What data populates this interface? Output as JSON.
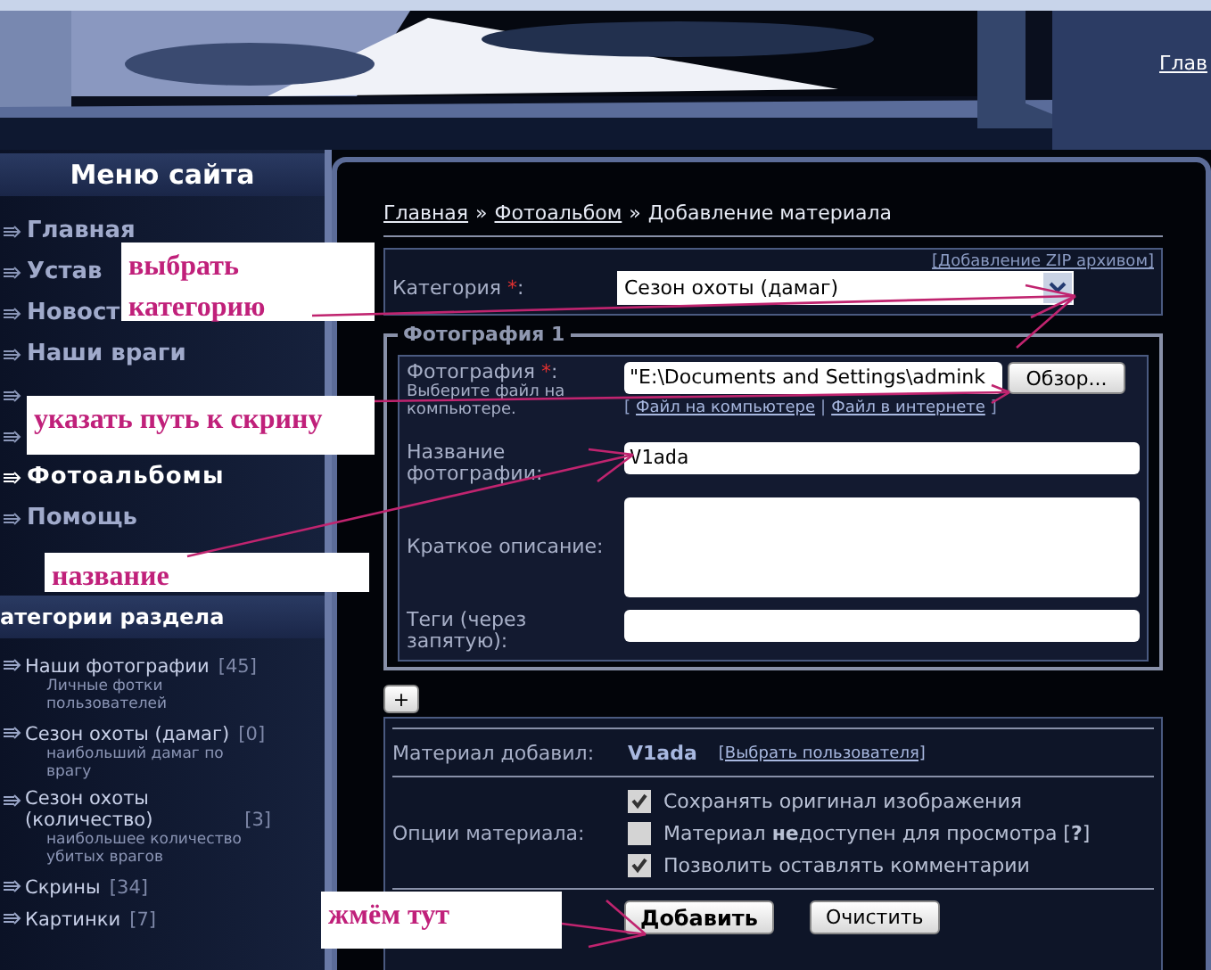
{
  "header": {
    "top_link": "Глав"
  },
  "sidebar": {
    "menu_title": "Меню сайта",
    "menu": [
      {
        "label": "Главная",
        "selected": false
      },
      {
        "label": "Устав",
        "selected": false
      },
      {
        "label": "Новост",
        "selected": false
      },
      {
        "label": "Наши враги",
        "selected": false
      },
      {
        "selected": false
      },
      {
        "selected": false
      },
      {
        "label": "Фотоальбомы",
        "selected": true
      },
      {
        "label": "Помощь",
        "selected": false
      }
    ],
    "categories_title": "атегории раздела",
    "categories": [
      {
        "name": "Наши фотографии",
        "count": "[45]",
        "description": "Личные фотки пользователей"
      },
      {
        "name": "Сезон охоты (дамаг)",
        "count": "[0]",
        "description": "наибольший дамаг по врагу"
      },
      {
        "name": "Сезон охоты (количество)",
        "count": "[3]",
        "description": "наибольшее количество убитых врагов"
      },
      {
        "name": "Скрины",
        "count": "[34]"
      },
      {
        "name": "Картинки",
        "count": "[7]"
      }
    ]
  },
  "breadcrumb": {
    "separator": "»",
    "items": [
      {
        "label": "Главная",
        "kind": "link"
      },
      {
        "label": "Фотоальбом",
        "kind": "link"
      },
      {
        "label": "Добавление материала",
        "kind": "current"
      }
    ]
  },
  "category": {
    "label": "Категория",
    "required_mark": "*",
    "colon": ":",
    "value": "Сезон охоты (дамаг)",
    "zip_link": "[Добавление ZIP архивом]"
  },
  "photo": {
    "legend": "Фотография 1",
    "file_label": "Фотография",
    "required_mark": "*",
    "colon": ":",
    "file_hint": "Выберите файл на компьютере.",
    "file_value": "\"E:\\Documents and Settings\\admink",
    "browse_button": "Обзор...",
    "source_links": {
      "open": "[",
      "close": "]",
      "divider": "|",
      "items": [
        "Файл на компьютере",
        "Файл в интернете"
      ]
    },
    "name_label": "Название фотографии:",
    "name_value": "V1ada",
    "description_label": "Краткое описание:",
    "tags_label": "Теги (через запятую):"
  },
  "add_photo_button": "+",
  "options": {
    "author_label": "Материал добавил:",
    "author": "V1ada",
    "choose_user_link": "[Выбрать пользователя]",
    "options_label": "Опции материала:",
    "checkboxes": [
      {
        "label": "Сохранять оригинал изображения",
        "checked": true
      },
      {
        "label": "Материал **не**доступен для просмотра [**?**]",
        "checked": false
      },
      {
        "label": "Позволить оставлять комментарии",
        "checked": true
      }
    ],
    "buttons": [
      {
        "label": "Добавить",
        "kind": "primary"
      },
      {
        "label": "Очистить",
        "kind": "normal"
      }
    ]
  },
  "annotations": [
    {
      "text": "выбрать категорию"
    },
    {
      "text": "указать путь к скрину"
    },
    {
      "text": "название"
    },
    {
      "text": "жмём тут"
    }
  ]
}
